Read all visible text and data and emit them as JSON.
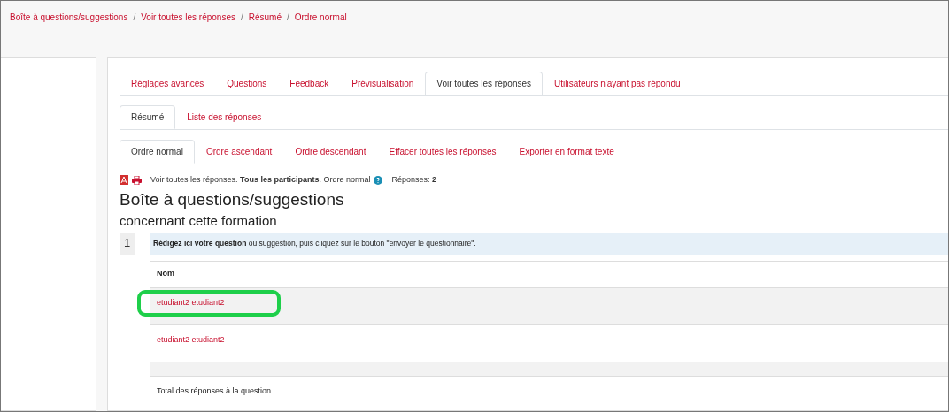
{
  "breadcrumb": [
    {
      "label": "Boîte à questions/suggestions"
    },
    {
      "separator": "/",
      "label": "Voir toutes les réponses"
    },
    {
      "separator": "/",
      "label": "Résumé"
    },
    {
      "separator": "/",
      "label": "Ordre normal"
    }
  ],
  "tabs": [
    {
      "label": "Réglages avancés",
      "selected": false
    },
    {
      "label": "Questions",
      "selected": false
    },
    {
      "label": "Feedback",
      "selected": false
    },
    {
      "label": "Prévisualisation",
      "selected": false
    },
    {
      "label": "Voir toutes les réponses",
      "selected": true
    },
    {
      "label": "Utilisateurs n'ayant pas répondu",
      "selected": false
    }
  ],
  "subtabs": [
    {
      "label": "Résumé",
      "selected": true
    },
    {
      "label": "Liste des réponses",
      "selected": false
    }
  ],
  "order_tabs": [
    {
      "label": "Ordre normal",
      "selected": true
    },
    {
      "label": "Ordre ascendant",
      "selected": false
    },
    {
      "label": "Ordre descendant",
      "selected": false
    },
    {
      "label": "Effacer toutes les réponses",
      "selected": false
    },
    {
      "label": "Exporter en format texte",
      "selected": false
    }
  ],
  "info_line": "Voir toutes les réponses. **Tous les participants**. Ordre normal",
  "responses": "Réponses: **2**",
  "title": "Boîte à questions/suggestions",
  "subtitle": "concernant cette formation",
  "question": {
    "number": "1",
    "text": "**Rédigez ici votre question** ou suggestion, puis cliquez sur le bouton \"envoyer le questionnaire\"."
  },
  "table": {
    "header": "Nom",
    "rows": [
      {
        "name": "etudiant2 etudiant2",
        "highlighted": true
      },
      {
        "name": "etudiant2 etudiant2",
        "highlighted": false
      }
    ],
    "total": "Total des réponses à la question"
  }
}
